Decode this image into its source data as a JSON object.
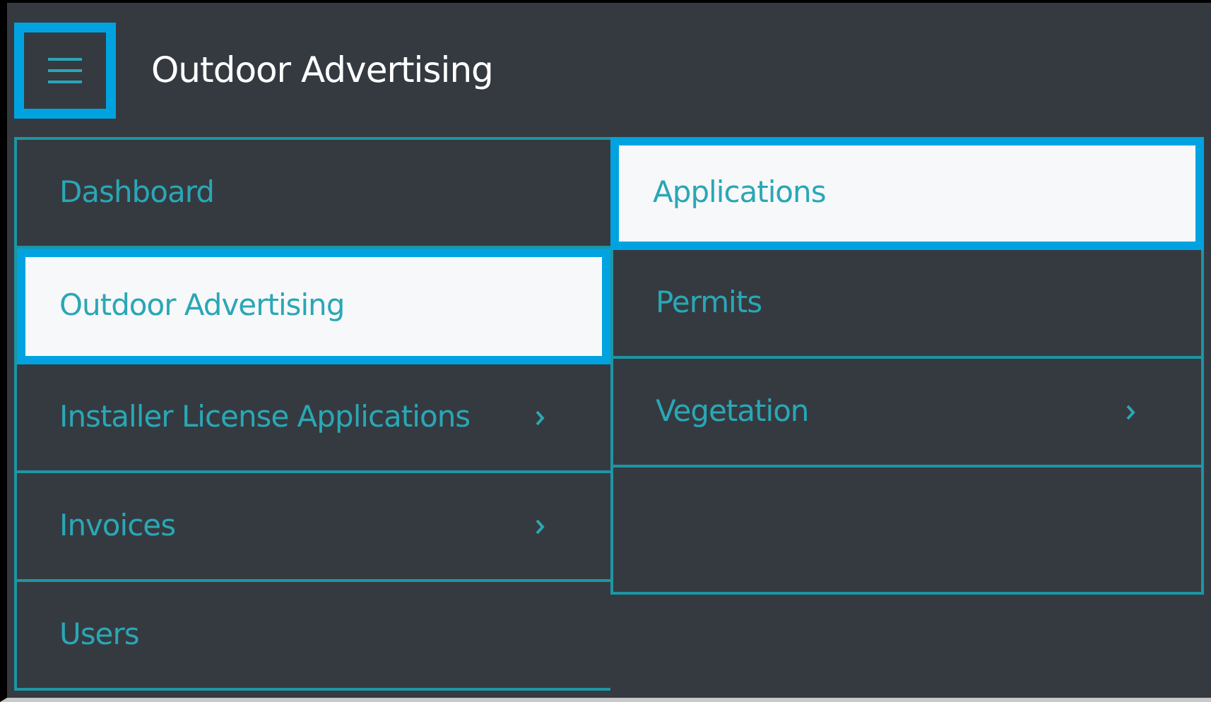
{
  "header": {
    "menu_button": {
      "highlighted": true
    },
    "title": "Outdoor Advertising"
  },
  "menu": [
    {
      "label": "Dashboard",
      "selected": false,
      "has_submenu": false
    },
    {
      "label": "Outdoor Advertising",
      "selected": true,
      "has_submenu": false
    },
    {
      "label": "Installer License Applications",
      "selected": false,
      "has_submenu": true
    },
    {
      "label": "Invoices",
      "selected": false,
      "has_submenu": true
    },
    {
      "label": "Users",
      "selected": false,
      "has_submenu": false
    }
  ],
  "submenu": [
    {
      "label": "Applications",
      "selected": true,
      "has_submenu": false
    },
    {
      "label": "Permits",
      "selected": false,
      "has_submenu": false
    },
    {
      "label": "Vegetation",
      "selected": false,
      "has_submenu": true
    }
  ]
}
